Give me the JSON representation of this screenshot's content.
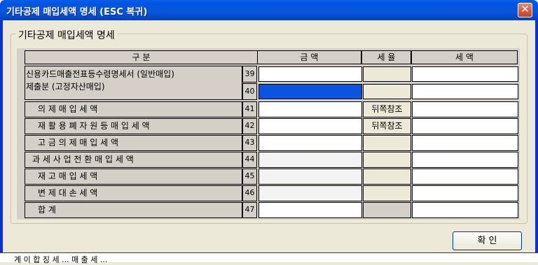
{
  "window": {
    "title": "기타공제 매입세액 명세 (ESC 복귀)",
    "close_glyph": "✕"
  },
  "group": {
    "label": "기타공제 매입세액 명세"
  },
  "headers": {
    "category": "구                                  분",
    "amount": "금      액",
    "rate": "세   율",
    "tax": "세      액"
  },
  "rows": [
    {
      "label1": "신용카드매출전표등수령명세서  (일반매입)",
      "label2": "제출분                           (고정자산매입)",
      "no_a": "39",
      "no_b": "40"
    },
    {
      "label": "의      제      매      입      세      액",
      "no": "41",
      "rate": "뒤쪽참조"
    },
    {
      "label": "재 활 용   폐 자 원 등   매 입 세 액",
      "no": "42",
      "rate": "뒤쪽참조"
    },
    {
      "label": "고   금   의   제        매   입   세   액",
      "no": "43"
    },
    {
      "label": "과 세 사 업 전 환   매 입 세 액",
      "no": "44"
    },
    {
      "label": "재      고      매      입      세      액",
      "no": "45"
    },
    {
      "label": "변      제      대      손      세      액",
      "no": "46"
    },
    {
      "label": "합                                         계",
      "no": "47"
    }
  ],
  "buttons": {
    "ok": "확  인"
  },
  "background_text": "계  이 합 징 세  ... 매 출 세 ..."
}
